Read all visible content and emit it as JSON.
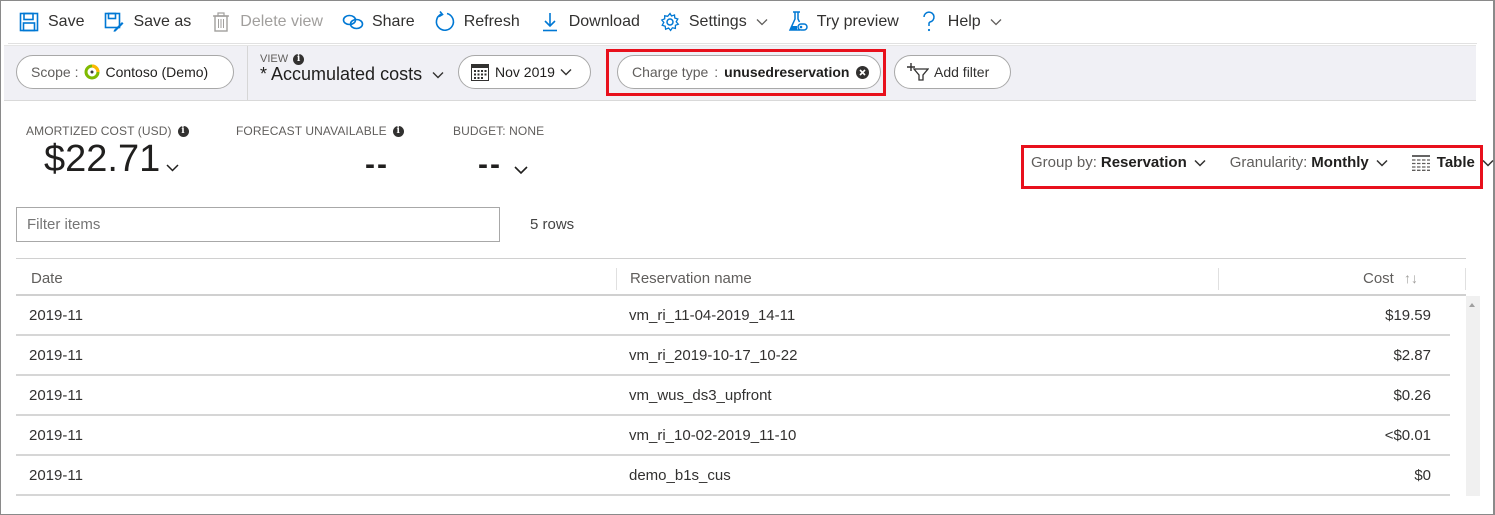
{
  "toolbar": {
    "items": [
      {
        "label": "Save",
        "icon": "save-icon",
        "enabled": true
      },
      {
        "label": "Save as",
        "icon": "save-as-icon",
        "enabled": true
      },
      {
        "label": "Delete view",
        "icon": "trash-icon",
        "enabled": false
      },
      {
        "label": "Share",
        "icon": "link-icon",
        "enabled": true
      },
      {
        "label": "Refresh",
        "icon": "refresh-icon",
        "enabled": true
      },
      {
        "label": "Download",
        "icon": "download-icon",
        "enabled": true
      },
      {
        "label": "Settings",
        "icon": "gear-icon",
        "enabled": true,
        "dropdown": true
      },
      {
        "label": "Try preview",
        "icon": "flask-icon",
        "enabled": true
      },
      {
        "label": "Help",
        "icon": "question-icon",
        "enabled": true,
        "dropdown": true
      }
    ]
  },
  "filterbar": {
    "scope_label": "Scope :",
    "scope_value": "Contoso (Demo)",
    "view_label": "VIEW",
    "view_value": "* Accumulated costs",
    "date_value": "Nov 2019",
    "filter_key": "Charge type",
    "filter_sep": ":",
    "filter_value": "unusedreservation",
    "add_filter_label": "Add filter"
  },
  "kpis": {
    "cost_label": "AMORTIZED COST (USD)",
    "cost_value": "$22.71",
    "forecast_label": "FORECAST UNAVAILABLE",
    "forecast_value": "--",
    "budget_label": "BUDGET: NONE",
    "budget_value": "--"
  },
  "controls": {
    "group_by_label": "Group by:",
    "group_by_value": "Reservation",
    "granularity_label": "Granularity:",
    "granularity_value": "Monthly",
    "chart_type_value": "Table"
  },
  "filter": {
    "placeholder": "Filter items",
    "value": "",
    "row_count": "5 rows"
  },
  "table": {
    "columns": [
      "Date",
      "Reservation name",
      "Cost"
    ],
    "sort_indicator": "↑↓",
    "rows": [
      {
        "date": "2019-11",
        "name": "vm_ri_11-04-2019_14-11",
        "cost": "$19.59"
      },
      {
        "date": "2019-11",
        "name": "vm_ri_2019-10-17_10-22",
        "cost": "$2.87"
      },
      {
        "date": "2019-11",
        "name": "vm_wus_ds3_upfront",
        "cost": "$0.26"
      },
      {
        "date": "2019-11",
        "name": "vm_ri_10-02-2019_11-10",
        "cost": "<$0.01"
      },
      {
        "date": "2019-11",
        "name": "demo_b1s_cus",
        "cost": "$0"
      }
    ]
  },
  "colors": {
    "accent": "#0078d4",
    "highlight": "#e8101c",
    "filterbar_bg": "#f0f0f5"
  }
}
